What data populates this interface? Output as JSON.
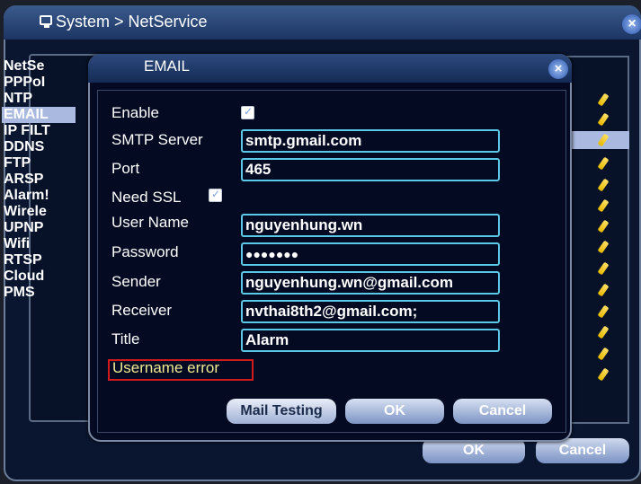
{
  "window": {
    "title": "System > NetService",
    "close_label": "×",
    "ok_label": "OK",
    "cancel_label": "Cancel"
  },
  "netservice_list": {
    "header": "NetSe",
    "items": [
      "PPPoI",
      "NTP",
      "EMAIL",
      "IP FILT",
      "DDNS",
      "FTP",
      "ARSP",
      "Alarm!",
      "Wirele",
      "UPNP",
      "Wifi",
      "RTSP",
      "Cloud",
      "PMS"
    ],
    "selected": "EMAIL"
  },
  "dialog": {
    "title": "EMAIL",
    "close_label": "×",
    "enable_label": "Enable",
    "enable_checked": true,
    "smtp_label": "SMTP Server",
    "smtp_value": "smtp.gmail.com",
    "port_label": "Port",
    "port_value": "465",
    "ssl_label": "Need SSL",
    "ssl_checked": true,
    "username_label": "User Name",
    "username_value": "nguyenhung.wn",
    "password_label": "Password",
    "password_value": "●●●●●●●",
    "sender_label": "Sender",
    "sender_value": "nguyenhung.wn@gmail.com",
    "receiver_label": "Receiver",
    "receiver_value": "nvthai8th2@gmail.com;",
    "title_label": "Title",
    "title_value": "Alarm",
    "error_text": "Username error",
    "mail_testing_label": "Mail Testing",
    "ok_label": "OK",
    "cancel_label": "Cancel"
  },
  "colors": {
    "field_border": "#5cc8e8",
    "error_border": "#d21a1a",
    "error_text": "#f0e890",
    "selection": "#a9b9e0"
  }
}
